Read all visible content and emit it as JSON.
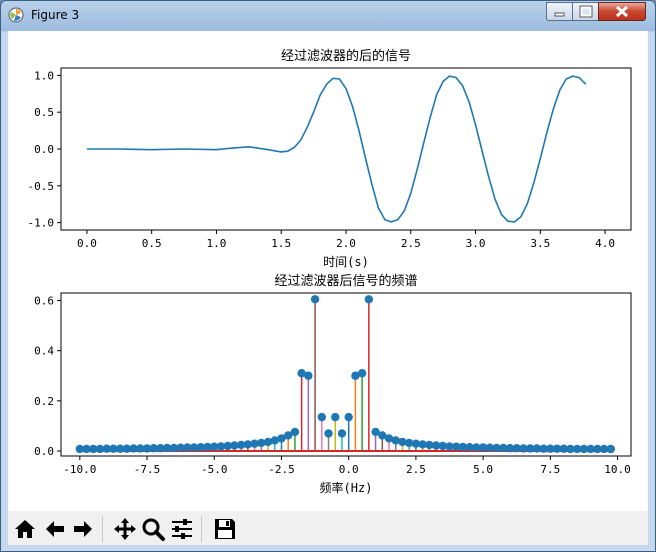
{
  "window": {
    "title": "Figure 3",
    "icon": "matplotlib-icon"
  },
  "window_controls": [
    "minimize-icon",
    "maximize-icon",
    "close-icon"
  ],
  "toolbar": {
    "buttons": [
      "home-icon",
      "back-icon",
      "forward-icon",
      "pan-icon",
      "zoom-icon",
      "configure-subplots-icon",
      "save-icon"
    ]
  },
  "colors": {
    "line": "#1f77b4",
    "baseline": "#d62728",
    "titlebar": "#b9d1ea"
  },
  "chart_data": [
    {
      "type": "line",
      "title": "经过滤波器的后的信号",
      "xlabel": "时间(s)",
      "ylabel": "",
      "xlim": [
        -0.2,
        4.2
      ],
      "ylim": [
        -1.1,
        1.1
      ],
      "xticks": [
        0.0,
        0.5,
        1.0,
        1.5,
        2.0,
        2.5,
        3.0,
        3.5,
        4.0
      ],
      "xticklabels": [
        "0.0",
        "0.5",
        "1.0",
        "1.5",
        "2.0",
        "2.5",
        "3.0",
        "3.5",
        "4.0"
      ],
      "yticks": [
        -1.0,
        -0.5,
        0.0,
        0.5,
        1.0
      ],
      "yticklabels": [
        "-1.0",
        "-0.5",
        "0.0",
        "0.5",
        "1.0"
      ],
      "x": [
        0.0,
        0.25,
        0.5,
        0.75,
        1.0,
        1.1,
        1.25,
        1.4,
        1.5,
        1.55,
        1.6,
        1.65,
        1.7,
        1.75,
        1.8,
        1.85,
        1.9,
        1.95,
        2.0,
        2.05,
        2.1,
        2.15,
        2.2,
        2.25,
        2.3,
        2.35,
        2.4,
        2.45,
        2.5,
        2.55,
        2.6,
        2.65,
        2.7,
        2.75,
        2.8,
        2.85,
        2.9,
        2.95,
        3.0,
        3.05,
        3.1,
        3.15,
        3.2,
        3.25,
        3.3,
        3.35,
        3.4,
        3.45,
        3.5,
        3.55,
        3.6,
        3.65,
        3.7,
        3.75,
        3.8,
        3.85,
        3.9,
        3.95,
        4.0
      ],
      "y": [
        0.0,
        0.0,
        -0.01,
        0.0,
        -0.01,
        0.01,
        0.03,
        -0.01,
        -0.04,
        -0.03,
        0.02,
        0.12,
        0.29,
        0.5,
        0.73,
        0.88,
        0.96,
        0.95,
        0.82,
        0.58,
        0.25,
        -0.12,
        -0.48,
        -0.8,
        -0.96,
        -0.99,
        -0.96,
        -0.84,
        -0.6,
        -0.27,
        0.08,
        0.43,
        0.74,
        0.92,
        0.99,
        0.97,
        0.86,
        0.64,
        0.33,
        -0.02,
        -0.37,
        -0.68,
        -0.89,
        -0.98,
        -0.99,
        -0.92,
        -0.74,
        -0.46,
        -0.13,
        0.22,
        0.54,
        0.8,
        0.95,
        0.99,
        0.97,
        0.88
      ]
    },
    {
      "type": "stem",
      "title": "经过滤波器后信号的频谱",
      "xlabel": "频率(Hz)",
      "ylabel": "",
      "xlim": [
        -10.7,
        10.5
      ],
      "ylim": [
        -0.02,
        0.63
      ],
      "xticks": [
        -10.0,
        -7.5,
        -5.0,
        -2.5,
        0.0,
        2.5,
        5.0,
        7.5,
        10.0
      ],
      "xticklabels": [
        "-10.0",
        "-7.5",
        "-5.0",
        "-2.5",
        "0.0",
        "2.5",
        "5.0",
        "7.5",
        "10.0"
      ],
      "yticks": [
        0.0,
        0.2,
        0.4,
        0.6
      ],
      "yticklabels": [
        "0.0",
        "0.2",
        "0.4",
        "0.6"
      ],
      "x": [
        -10.0,
        -9.75,
        -9.5,
        -9.25,
        -9.0,
        -8.75,
        -8.5,
        -8.25,
        -8.0,
        -7.75,
        -7.5,
        -7.25,
        -7.0,
        -6.75,
        -6.5,
        -6.25,
        -6.0,
        -5.75,
        -5.5,
        -5.25,
        -5.0,
        -4.75,
        -4.5,
        -4.25,
        -4.0,
        -3.75,
        -3.5,
        -3.25,
        -3.0,
        -2.75,
        -2.5,
        -2.25,
        -2.0,
        -1.75,
        -1.5,
        -1.25,
        -1.0,
        -0.75,
        -0.5,
        -0.25,
        0.0,
        0.25,
        0.5,
        0.75,
        1.0,
        1.25,
        1.5,
        1.75,
        2.0,
        2.25,
        2.5,
        2.75,
        3.0,
        3.25,
        3.5,
        3.75,
        4.0,
        4.25,
        4.5,
        4.75,
        5.0,
        5.25,
        5.5,
        5.75,
        6.0,
        6.25,
        6.5,
        6.75,
        7.0,
        7.25,
        7.5,
        7.75,
        8.0,
        8.25,
        8.5,
        8.75,
        9.0,
        9.25,
        9.5,
        9.75
      ],
      "y": [
        0.008,
        0.008,
        0.008,
        0.008,
        0.009,
        0.009,
        0.009,
        0.009,
        0.01,
        0.01,
        0.01,
        0.011,
        0.011,
        0.012,
        0.012,
        0.013,
        0.014,
        0.014,
        0.015,
        0.016,
        0.017,
        0.018,
        0.02,
        0.022,
        0.024,
        0.026,
        0.029,
        0.032,
        0.036,
        0.042,
        0.05,
        0.062,
        0.076,
        0.31,
        0.3,
        0.605,
        0.135,
        0.07,
        0.135,
        0.07,
        0.135,
        0.3,
        0.31,
        0.605,
        0.076,
        0.062,
        0.05,
        0.042,
        0.036,
        0.032,
        0.029,
        0.026,
        0.024,
        0.022,
        0.02,
        0.018,
        0.017,
        0.016,
        0.015,
        0.014,
        0.014,
        0.013,
        0.012,
        0.012,
        0.011,
        0.011,
        0.01,
        0.01,
        0.01,
        0.009,
        0.009,
        0.009,
        0.009,
        0.008,
        0.008,
        0.008,
        0.008,
        0.008,
        0.008,
        0.008
      ]
    }
  ]
}
